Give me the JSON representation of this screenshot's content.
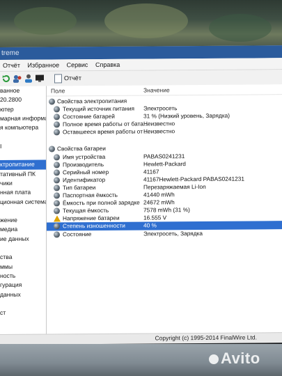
{
  "window": {
    "title": "treme"
  },
  "menu": [
    "Отчёт",
    "Избранное",
    "Сервис",
    "Справка"
  ],
  "toolbar": {
    "report_label": "Отчёт"
  },
  "left_panel": {
    "items": [
      "ванное",
      "20.2800",
      "ютер",
      "марная информа",
      "я компьютера",
      "",
      "I",
      "",
      "ктропитание",
      "тативный ПК",
      "чики",
      "нная плата",
      "ционная система",
      "",
      "жение",
      "медиа",
      "ие данных",
      "",
      "ства",
      "ммы",
      "ность",
      "гурация",
      "данных",
      "",
      "ст",
      ""
    ],
    "selected_index": 8
  },
  "columns": {
    "field": "Поле",
    "value": "Значение"
  },
  "sections": [
    {
      "title": "Свойства электропитания",
      "rows": [
        {
          "field": "Текущий источник питания",
          "value": "Электросеть"
        },
        {
          "field": "Состояние батарей",
          "value": "31 % (Низкий уровень, Зарядка)"
        },
        {
          "field": "Полное время работы от бата...",
          "value": "Неизвестно"
        },
        {
          "field": "Оставшееся время работы от ...",
          "value": "Неизвестно"
        }
      ]
    },
    {
      "title": "Свойства батареи",
      "rows": [
        {
          "field": "Имя устройства",
          "value": "PABAS0241231"
        },
        {
          "field": "Производитель",
          "value": "Hewlett-Packard"
        },
        {
          "field": "Серийный номер",
          "value": "41167"
        },
        {
          "field": "Идентификатор",
          "value": "41167Hewlett-Packard PABAS0241231"
        },
        {
          "field": "Тип батареи",
          "value": "Перезаряжаемая Li-Ion"
        },
        {
          "field": "Паспортная ёмкость",
          "value": "41440 mWh"
        },
        {
          "field": "Ёмкость при полной зарядке",
          "value": "24672 mWh"
        },
        {
          "field": "Текущая ёмкость",
          "value": "7578 mWh  (31 %)"
        },
        {
          "field": "Напряжение батареи",
          "value": "16.555 V",
          "icon": "warning-icon"
        },
        {
          "field": "Степень изношенности",
          "value": "40 %",
          "highlighted": true
        },
        {
          "field": "Состояние",
          "value": "Электросеть, Зарядка"
        }
      ]
    }
  ],
  "status": {
    "copyright": "Copyright (c) 1995-2014 FinalWire Ltd."
  },
  "watermark": "Avito",
  "colors": {
    "selection": "#2f6fd0",
    "titlebar": "#2b5b9c",
    "warning": "#e0a400"
  }
}
